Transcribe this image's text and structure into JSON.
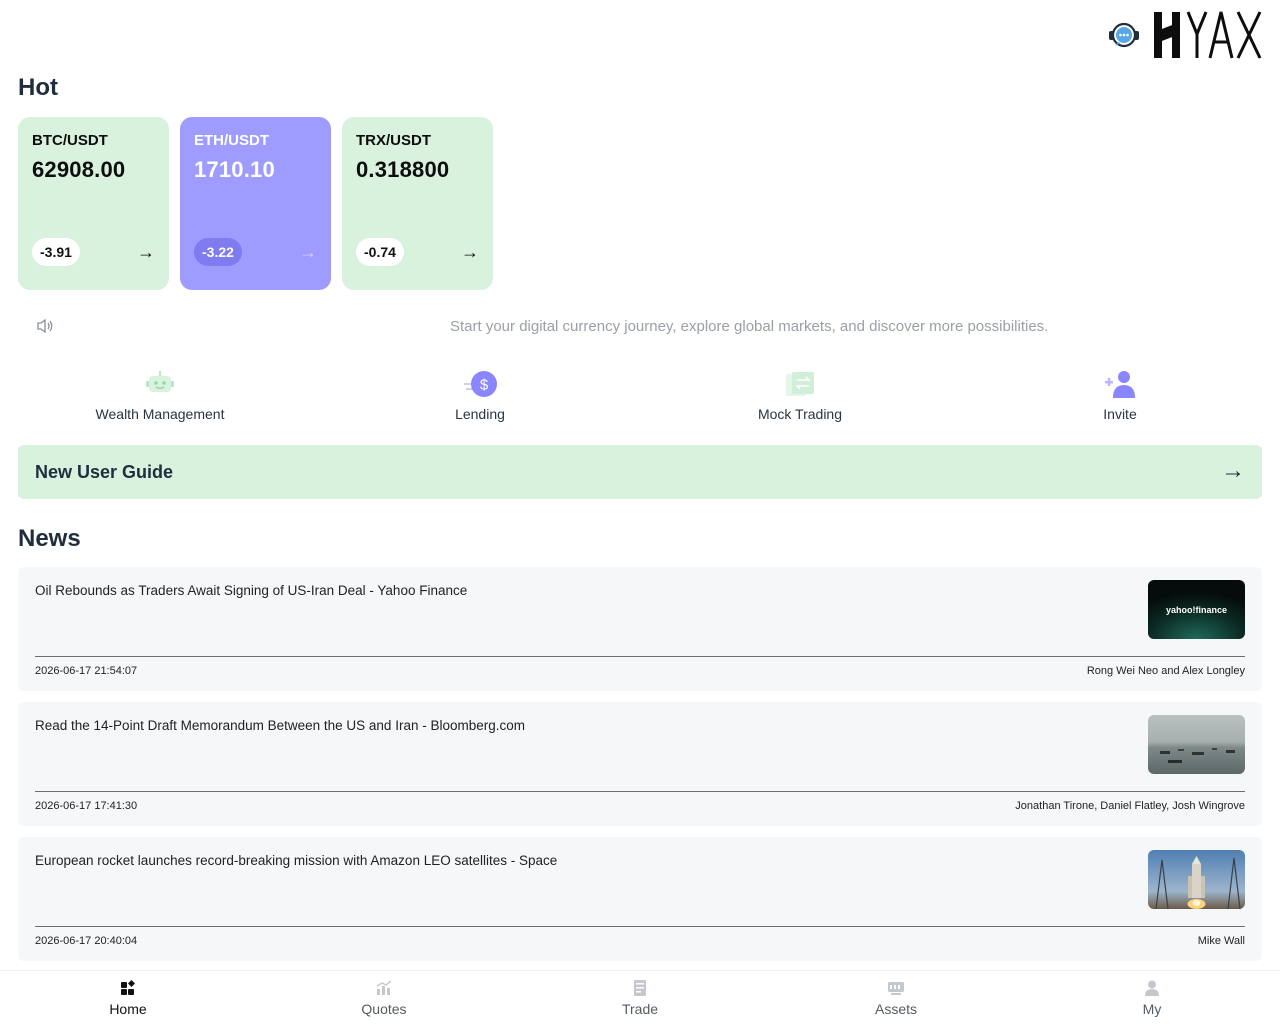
{
  "header": {
    "support_icon": "customer-support-headset-icon",
    "logo_text": "YAX"
  },
  "hot": {
    "title": "Hot",
    "cards": [
      {
        "pair": "BTC/USDT",
        "price": "62908.00",
        "change": "-3.91",
        "arrow": "→",
        "theme": "green"
      },
      {
        "pair": "ETH/USDT",
        "price": "1710.10",
        "change": "-3.22",
        "arrow": "→",
        "theme": "purple"
      },
      {
        "pair": "TRX/USDT",
        "price": "0.318800",
        "change": "-0.74",
        "arrow": "→",
        "theme": "green"
      }
    ]
  },
  "notice": {
    "icon": "speaker-icon",
    "text": "Start your digital currency journey, explore global markets, and discover more possibilities."
  },
  "features": [
    {
      "label": "Wealth Management",
      "icon": "robot-icon"
    },
    {
      "label": "Lending",
      "icon": "dollar-coin-icon"
    },
    {
      "label": "Mock Trading",
      "icon": "exchange-card-icon"
    },
    {
      "label": "Invite",
      "icon": "add-user-icon"
    }
  ],
  "guide": {
    "label": "New User Guide",
    "arrow": "→"
  },
  "news": {
    "title": "News",
    "items": [
      {
        "title": "Oil Rebounds as Traders Await Signing of US-Iran Deal - Yahoo Finance",
        "date": "2026-06-17 21:54:07",
        "author": "Rong Wei Neo and Alex Longley",
        "thumb_text": "yahoo!finance"
      },
      {
        "title": "Read the 14-Point Draft Memorandum Between the US and Iran - Bloomberg.com",
        "date": "2026-06-17 17:41:30",
        "author": "Jonathan Tirone, Daniel Flatley, Josh Wingrove"
      },
      {
        "title": "European rocket launches record-breaking mission with Amazon LEO satellites - Space",
        "date": "2026-06-17 20:40:04",
        "author": "Mike Wall"
      }
    ]
  },
  "bottom_nav": [
    {
      "label": "Home",
      "icon": "home-grid-icon",
      "active": true
    },
    {
      "label": "Quotes",
      "icon": "chart-icon",
      "active": false
    },
    {
      "label": "Trade",
      "icon": "trade-document-icon",
      "active": false
    },
    {
      "label": "Assets",
      "icon": "wallet-icon",
      "active": false
    },
    {
      "label": "My",
      "icon": "user-icon",
      "active": false
    }
  ],
  "colors": {
    "card_green": "#d8f2de",
    "card_purple": "#9e9cff",
    "accent_purple": "#8a86ff",
    "text_dark": "#1f2d3d"
  }
}
